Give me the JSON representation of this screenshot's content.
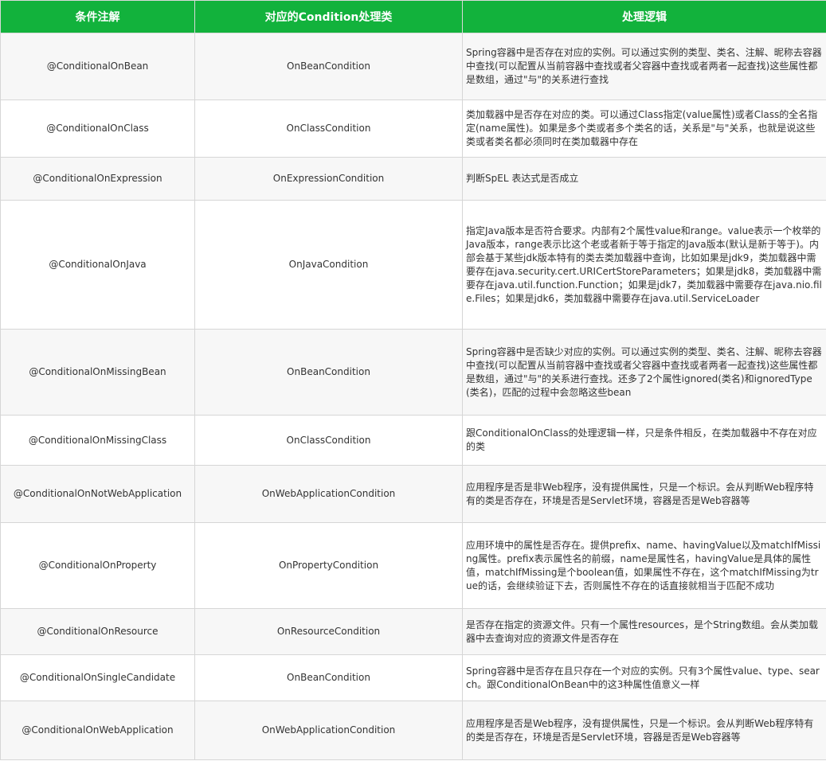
{
  "table": {
    "headers": [
      "条件注解",
      "对应的Condition处理类",
      "处理逻辑"
    ],
    "rows": [
      {
        "annotation": "@ConditionalOnBean",
        "condition_class": "OnBeanCondition",
        "logic": "Spring容器中是否存在对应的实例。可以通过实例的类型、类名、注解、昵称去容器中查找(可以配置从当前容器中查找或者父容器中查找或者两者一起查找)这些属性都是数组，通过\"与\"的关系进行查找"
      },
      {
        "annotation": "@ConditionalOnClass",
        "condition_class": "OnClassCondition",
        "logic": "类加载器中是否存在对应的类。可以通过Class指定(value属性)或者Class的全名指定(name属性)。如果是多个类或者多个类名的话，关系是\"与\"关系，也就是说这些类或者类名都必须同时在类加载器中存在"
      },
      {
        "annotation": "@ConditionalOnExpression",
        "condition_class": "OnExpressionCondition",
        "logic": "判断SpEL 表达式是否成立"
      },
      {
        "annotation": "@ConditionalOnJava",
        "condition_class": "OnJavaCondition",
        "logic": "指定Java版本是否符合要求。内部有2个属性value和range。value表示一个枚举的Java版本，range表示比这个老或者新于等于指定的Java版本(默认是新于等于)。内部会基于某些jdk版本特有的类去类加载器中查询，比如如果是jdk9，类加载器中需要存在java.security.cert.URICertStoreParameters；如果是jdk8，类加载器中需要存在java.util.function.Function；如果是jdk7，类加载器中需要存在java.nio.file.Files；如果是jdk6，类加载器中需要存在java.util.ServiceLoader"
      },
      {
        "annotation": "@ConditionalOnMissingBean",
        "condition_class": "OnBeanCondition",
        "logic": "Spring容器中是否缺少对应的实例。可以通过实例的类型、类名、注解、昵称去容器中查找(可以配置从当前容器中查找或者父容器中查找或者两者一起查找)这些属性都是数组，通过\"与\"的关系进行查找。还多了2个属性ignored(类名)和ignoredType(类名)，匹配的过程中会忽略这些bean"
      },
      {
        "annotation": "@ConditionalOnMissingClass",
        "condition_class": "OnClassCondition",
        "logic": "跟ConditionalOnClass的处理逻辑一样，只是条件相反，在类加载器中不存在对应的类"
      },
      {
        "annotation": "@ConditionalOnNotWebApplication",
        "condition_class": "OnWebApplicationCondition",
        "logic": "应用程序是否是非Web程序，没有提供属性，只是一个标识。会从判断Web程序特有的类是否存在，环境是否是Servlet环境，容器是否是Web容器等"
      },
      {
        "annotation": "@ConditionalOnProperty",
        "condition_class": "OnPropertyCondition",
        "logic": "应用环境中的属性是否存在。提供prefix、name、havingValue以及matchIfMissing属性。prefix表示属性名的前缀，name是属性名，havingValue是具体的属性值，matchIfMissing是个boolean值，如果属性不存在，这个matchIfMissing为true的话，会继续验证下去，否则属性不存在的话直接就相当于匹配不成功"
      },
      {
        "annotation": "@ConditionalOnResource",
        "condition_class": "OnResourceCondition",
        "logic": "是否存在指定的资源文件。只有一个属性resources，是个String数组。会从类加载器中去查询对应的资源文件是否存在"
      },
      {
        "annotation": "@ConditionalOnSingleCandidate",
        "condition_class": "OnBeanCondition",
        "logic": "Spring容器中是否存在且只存在一个对应的实例。只有3个属性value、type、search。跟ConditionalOnBean中的这3种属性值意义一样"
      },
      {
        "annotation": "@ConditionalOnWebApplication",
        "condition_class": "OnWebApplicationCondition",
        "logic": "应用程序是否是Web程序，没有提供属性，只是一个标识。会从判断Web程序特有的类是否存在，环境是否是Servlet环境，容器是否是Web容器等"
      }
    ]
  }
}
